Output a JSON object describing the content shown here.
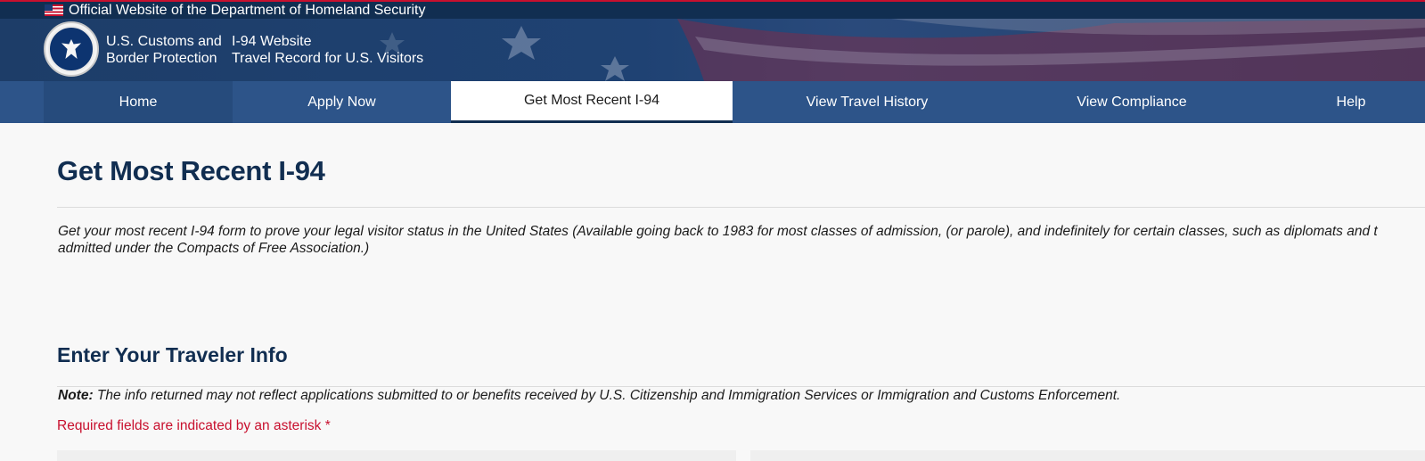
{
  "banner": {
    "text": "Official Website of the Department of Homeland Security",
    "flag_icon": "us-flag-icon"
  },
  "header": {
    "seal_icon": "cbp-seal-icon",
    "agency_line1": "U.S. Customs and",
    "agency_line2": "Border Protection",
    "site_line1": "I-94 Website",
    "site_line2": "Travel Record for U.S. Visitors"
  },
  "nav": {
    "items": [
      {
        "label": "Home"
      },
      {
        "label": "Apply Now"
      },
      {
        "label": "Get Most Recent I-94",
        "active": true
      },
      {
        "label": "View Travel History"
      },
      {
        "label": "View Compliance"
      },
      {
        "label": "Help"
      }
    ]
  },
  "main": {
    "title": "Get Most Recent I-94",
    "intro_line1": "Get your most recent I-94 form to prove your legal visitor status in the United States (Available going back to 1983 for most classes of admission, (or parole), and indefinitely for certain classes, such as diplomats and t",
    "intro_line2": "admitted under the Compacts of Free Association.)",
    "section_title": "Enter Your Traveler Info",
    "note_label": "Note:",
    "note_text": " The info returned may not reflect applications submitted to or benefits received by U.S. Citizenship and Immigration Services or Immigration and Customs Enforcement.",
    "required_text": "Required fields are indicated by an asterisk *"
  },
  "colors": {
    "navy": "#112e51",
    "nav_blue": "#2d5489",
    "required_red": "#c8102e"
  }
}
